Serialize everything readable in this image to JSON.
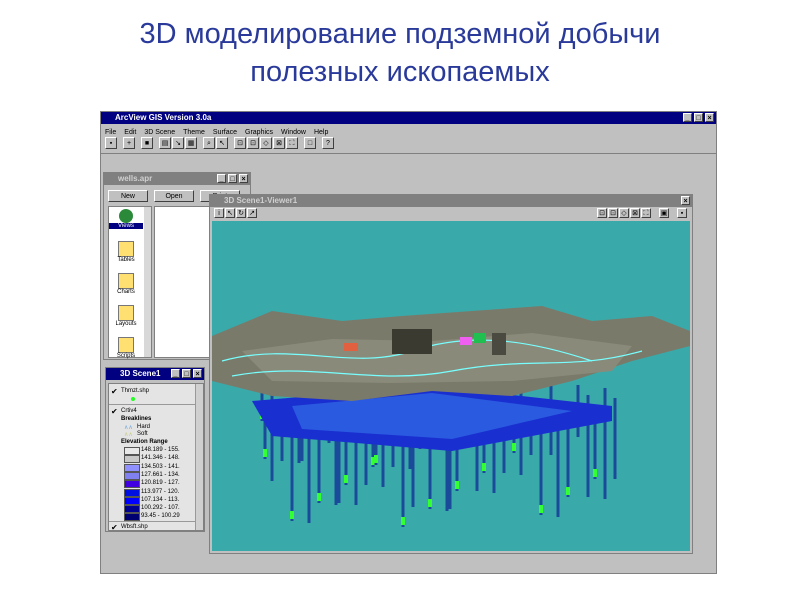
{
  "slide": {
    "title_line1": "3D моделирование подземной добычи",
    "title_line2": "полезных ископаемых"
  },
  "app": {
    "title": "ArcView GIS Version 3.0a",
    "menu": [
      "File",
      "Edit",
      "3D Scene",
      "Theme",
      "Surface",
      "Graphics",
      "Window",
      "Help"
    ]
  },
  "project": {
    "title": "wells.apr",
    "buttons": [
      "New",
      "Open",
      "Print"
    ],
    "items": [
      "Views",
      "Tables",
      "Charts",
      "Layouts",
      "Scripts"
    ]
  },
  "legend": {
    "title": "3D Scene1",
    "themes": [
      {
        "name": "Thmzt.shp"
      },
      {
        "name": "Crtiv4",
        "sub": "Breaklines",
        "lines": [
          "Hard",
          "Soft"
        ],
        "range_label": "Elevation Range"
      },
      {
        "name": "Wbsft.shp"
      }
    ],
    "ranges": [
      {
        "label": "148.189 - 155.",
        "color": "#e8e8e8"
      },
      {
        "label": "141.346 - 148.",
        "color": "#c8c8c8"
      },
      {
        "label": "134.503 - 141.",
        "color": "#9090ff"
      },
      {
        "label": "127.661 - 134.",
        "color": "#8080f0"
      },
      {
        "label": "120.819 - 127.",
        "color": "#4000e0"
      },
      {
        "label": "113.977 - 120.",
        "color": "#0010e0"
      },
      {
        "label": "107.134 - 113.",
        "color": "#0000ff"
      },
      {
        "label": "100.292 - 107.",
        "color": "#000090"
      },
      {
        "label": "93.45 - 100.29",
        "color": "#000070"
      }
    ]
  },
  "viewer": {
    "title": "3D Scene1-Viewer1",
    "background": "#3aa9a9"
  }
}
